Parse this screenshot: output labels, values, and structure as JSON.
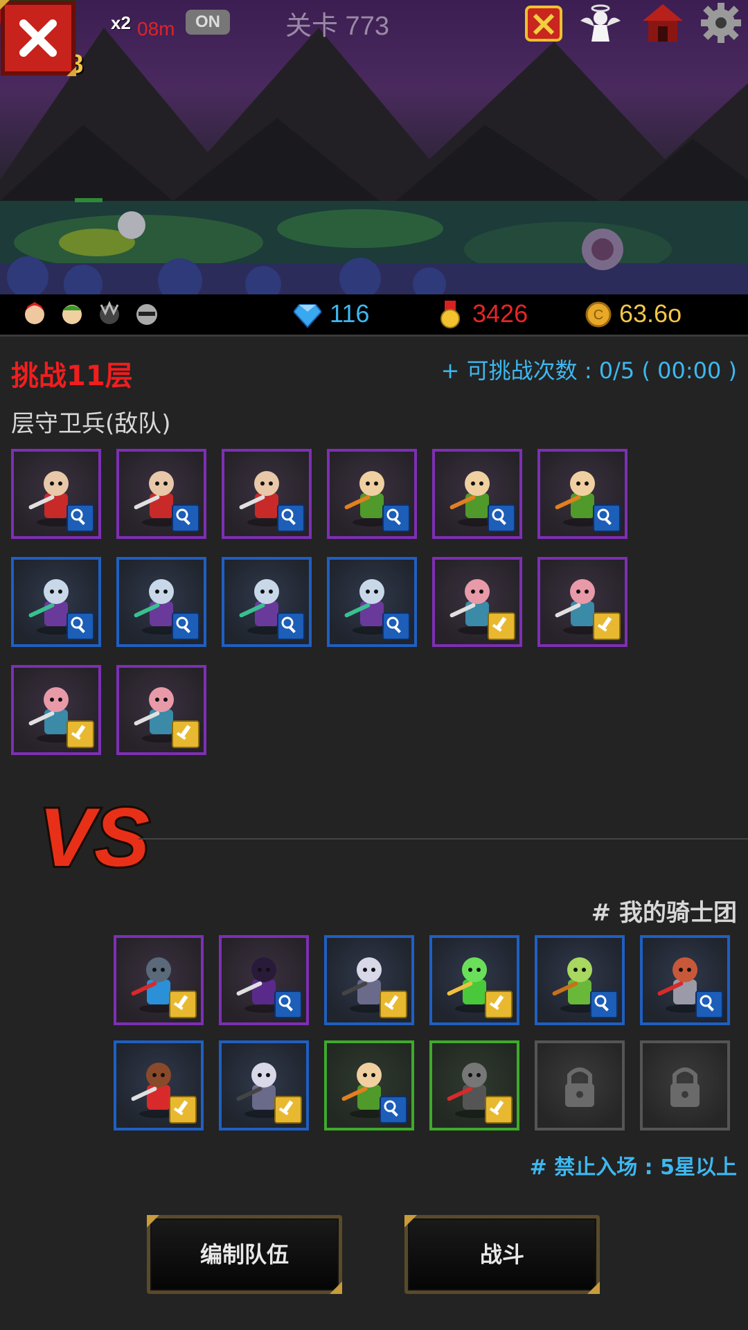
{
  "hud": {
    "player_level": "18",
    "speed_multiplier": "x2",
    "speed_time": "08m",
    "auto_toggle": "ON",
    "stage_title": "关卡 773"
  },
  "resources": {
    "gems": "116",
    "medals": "3426",
    "gold": "63.6o"
  },
  "panel": {
    "challenge_title": "挑战11层",
    "attempts": "+ 可挑战次数 : 0/5 ( 00:00 )",
    "enemy_label": "层守卫兵(敌队)",
    "my_team_label": "# 我的骑士团",
    "ban_label": "# 禁止入场 : 5星以上"
  },
  "enemy_team": [
    {
      "unit": "red-winged-knight",
      "frame": "purple",
      "badge": "magnifier"
    },
    {
      "unit": "red-winged-knight",
      "frame": "purple",
      "badge": "magnifier"
    },
    {
      "unit": "red-winged-knight",
      "frame": "purple",
      "badge": "magnifier"
    },
    {
      "unit": "green-elf-archer",
      "frame": "purple",
      "badge": "magnifier"
    },
    {
      "unit": "green-elf-archer",
      "frame": "purple",
      "badge": "magnifier"
    },
    {
      "unit": "green-elf-archer",
      "frame": "purple",
      "badge": "magnifier"
    },
    {
      "unit": "purple-hooded-mage",
      "frame": "blue",
      "badge": "magnifier"
    },
    {
      "unit": "purple-hooded-mage",
      "frame": "blue",
      "badge": "magnifier"
    },
    {
      "unit": "purple-hooded-mage",
      "frame": "blue",
      "badge": "magnifier"
    },
    {
      "unit": "purple-hooded-mage",
      "frame": "blue",
      "badge": "magnifier"
    },
    {
      "unit": "viking-hammer-warrior",
      "frame": "purple",
      "badge": "sword"
    },
    {
      "unit": "viking-hammer-warrior",
      "frame": "purple",
      "badge": "sword"
    },
    {
      "unit": "viking-hammer-warrior",
      "frame": "purple",
      "badge": "sword"
    },
    {
      "unit": "viking-hammer-warrior",
      "frame": "purple",
      "badge": "sword"
    }
  ],
  "my_team": [
    {
      "unit": "blue-spiked-brute",
      "frame": "purple",
      "badge": "sword"
    },
    {
      "unit": "hooded-necromancer",
      "frame": "purple",
      "badge": "magnifier"
    },
    {
      "unit": "flail-skeleton-knight",
      "frame": "blue",
      "badge": "sword"
    },
    {
      "unit": "green-bird",
      "frame": "blue",
      "badge": "sword"
    },
    {
      "unit": "elf-bowman",
      "frame": "blue",
      "badge": "magnifier"
    },
    {
      "unit": "armored-swordsman",
      "frame": "blue",
      "badge": "magnifier"
    },
    {
      "unit": "red-swordsman",
      "frame": "blue",
      "badge": "sword"
    },
    {
      "unit": "flail-skeleton-knight",
      "frame": "blue",
      "badge": "sword"
    },
    {
      "unit": "green-elf-archer",
      "frame": "green",
      "badge": "magnifier"
    },
    {
      "unit": "dark-assassin",
      "frame": "green",
      "badge": "sword"
    },
    {
      "unit": "locked-slot",
      "frame": "locked",
      "badge": ""
    },
    {
      "unit": "locked-slot",
      "frame": "locked",
      "badge": ""
    }
  ],
  "buttons": {
    "edit_team": "编制队伍",
    "battle": "战斗"
  },
  "colors": {
    "challenge_red": "#f01e1e",
    "info_blue": "#3db8f0",
    "frame_purple": "#7d2fb5",
    "frame_blue": "#1f5fc2",
    "frame_green": "#3faa2c"
  }
}
